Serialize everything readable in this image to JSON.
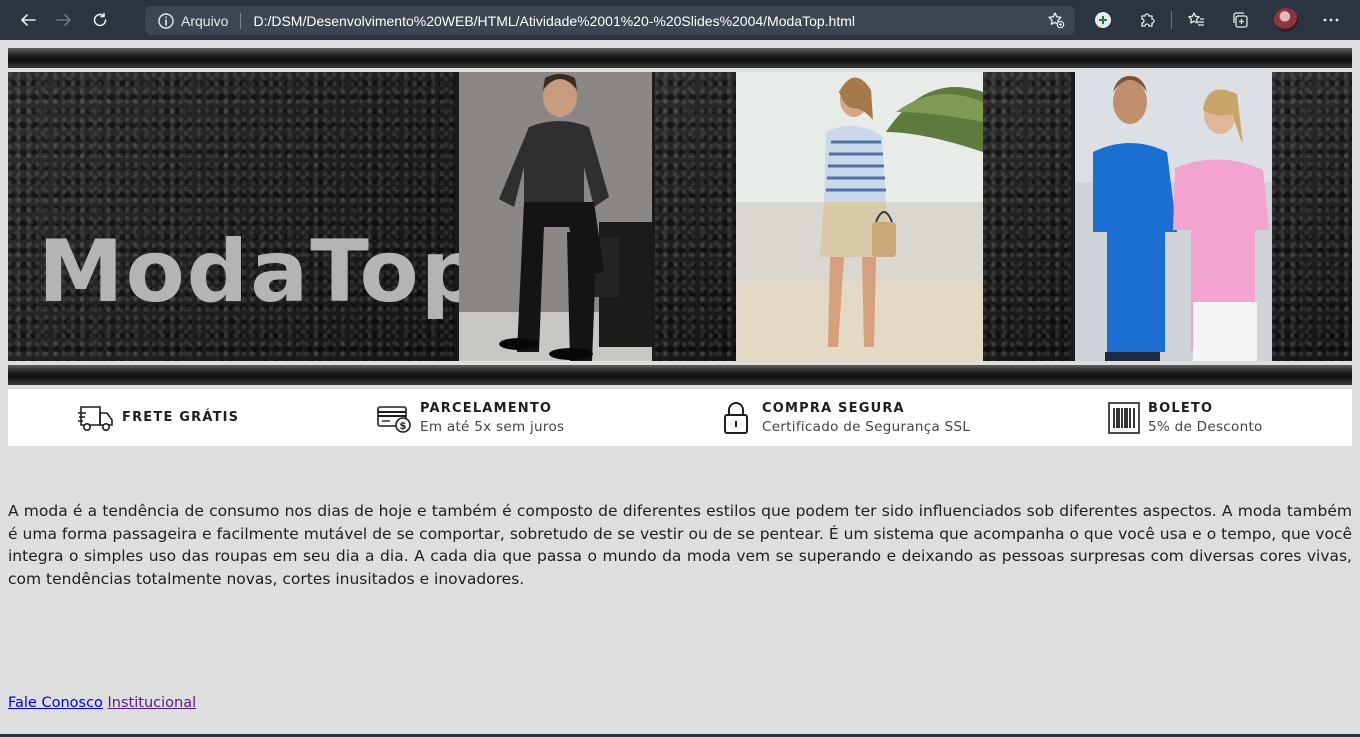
{
  "browser": {
    "scheme_label": "Arquivo",
    "url": "D:/DSM/Desenvolvimento%20WEB/HTML/Atividade%2001%20-%20Slides%2004/ModaTop.html",
    "icons": [
      "back-icon",
      "forward-icon",
      "reload-icon",
      "info-icon",
      "add-favorite-icon",
      "add-icon",
      "extensions-icon",
      "favorites-icon",
      "collections-icon",
      "profile-avatar",
      "more-icon"
    ]
  },
  "banner": {
    "brand": "ModaTop"
  },
  "benefits": [
    {
      "icon": "delivery-truck-icon",
      "title": "FRETE GRÁTIS",
      "subtitle": ""
    },
    {
      "icon": "credit-card-icon",
      "title": "PARCELAMENTO",
      "subtitle": "Em até 5x sem juros"
    },
    {
      "icon": "padlock-icon",
      "title": "COMPRA SEGURA",
      "subtitle": "Certificado de Segurança SSL"
    },
    {
      "icon": "barcode-icon",
      "title": "BOLETO",
      "subtitle": "5% de Desconto"
    }
  ],
  "content": {
    "paragraph": "A moda é a tendência de consumo nos dias de hoje e também é composto de diferentes estilos que podem ter sido influenciados sob diferentes aspectos. A moda também é uma forma passageira e facilmente mutável de se comportar, sobretudo de se vestir ou de se pentear. É um sistema que acompanha o que você usa e o tempo, que você integra o simples uso das roupas em seu dia a dia. A cada dia que passa o mundo da moda vem se superando e deixando as pessoas surpresas com diversas cores vivas, com tendências totalmente novas, cortes inusitados e inovadores."
  },
  "footer": {
    "contact_link": "Fale Conosco",
    "institutional_link": "Institucional"
  }
}
